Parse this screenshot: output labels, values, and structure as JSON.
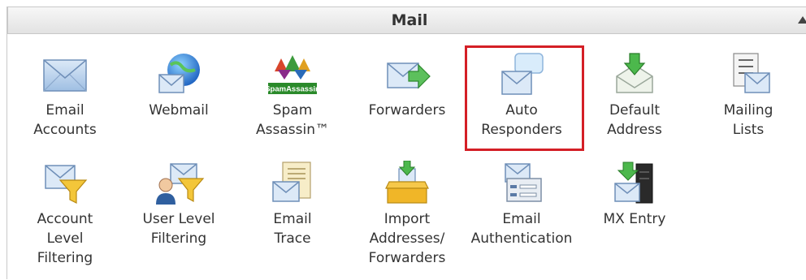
{
  "section": {
    "title": "Mail"
  },
  "items": [
    {
      "label": "Email\nAccounts",
      "icon": "envelope-icon"
    },
    {
      "label": "Webmail",
      "icon": "globe-envelope-icon"
    },
    {
      "label": "Spam\nAssassin™",
      "icon": "spamassassin-logo-icon",
      "logo_text": "SpamAssassin"
    },
    {
      "label": "Forwarders",
      "icon": "envelope-forward-arrow-icon"
    },
    {
      "label": "Auto\nResponders",
      "icon": "speech-bubble-envelope-icon"
    },
    {
      "label": "Default\nAddress",
      "icon": "envelope-download-arrow-icon"
    },
    {
      "label": "Mailing\nLists",
      "icon": "list-envelope-icon"
    },
    {
      "label": "Account\nLevel\nFiltering",
      "icon": "envelope-funnel-icon"
    },
    {
      "label": "User Level\nFiltering",
      "icon": "user-envelope-funnel-icon"
    },
    {
      "label": "Email\nTrace",
      "icon": "document-trace-envelope-icon"
    },
    {
      "label": "Import\nAddresses/\nForwarders",
      "icon": "import-box-icon"
    },
    {
      "label": "Email\nAuthentication",
      "icon": "authentication-card-icon"
    },
    {
      "label": "MX Entry",
      "icon": "server-envelope-icon"
    }
  ],
  "highlighted_item": "Auto\nResponders",
  "colors": {
    "highlight": "#d41f26",
    "header_bg": "#e6e6e6"
  }
}
